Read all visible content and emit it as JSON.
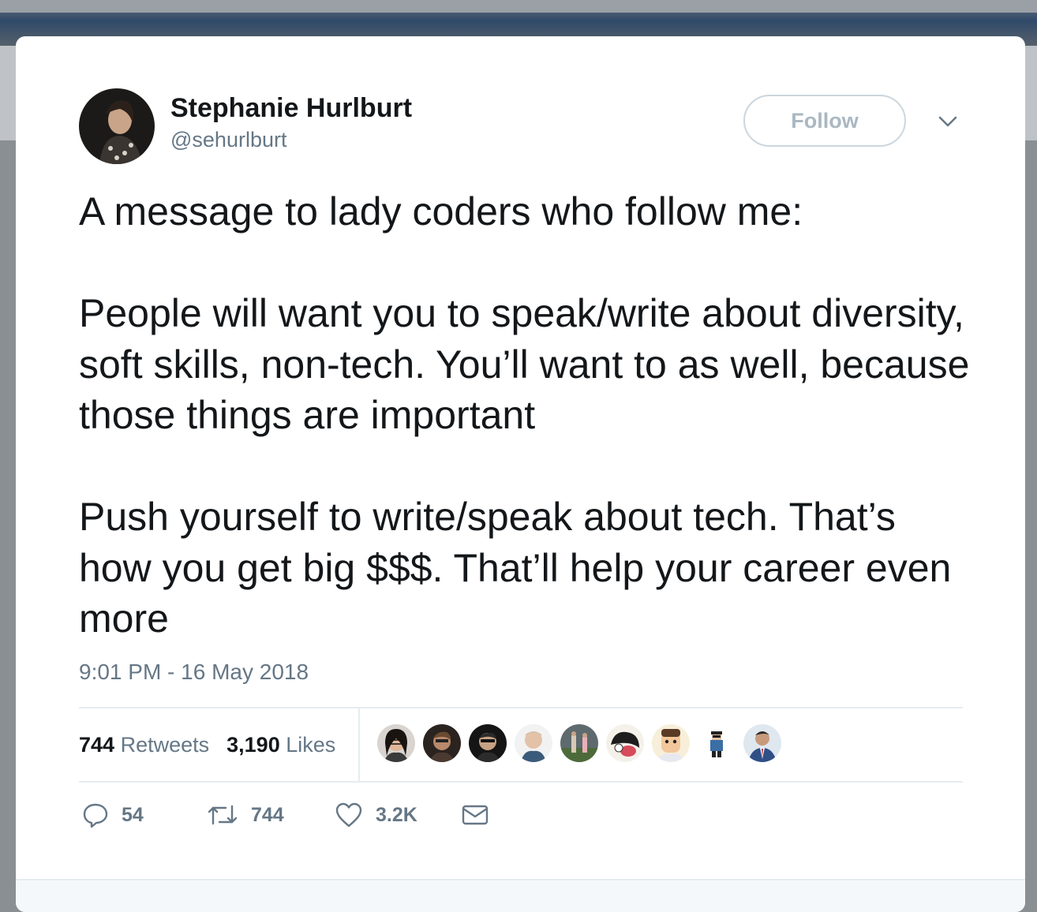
{
  "tweet": {
    "author_name": "Stephanie Hurlburt",
    "author_handle": "@sehurlburt",
    "follow_label": "Follow",
    "text": "A message to lady coders who follow me:\n\nPeople will want you to speak/write about diversity, soft skills, non-tech. You’ll want to as well, because those things are important\n\nPush yourself to write/speak about tech. That’s how you get big $$$. That’ll help your career even more",
    "timestamp": "9:01 PM - 16 May 2018",
    "stats": {
      "retweets_count": "744",
      "retweets_label": "Retweets",
      "likes_count": "3,190",
      "likes_label": "Likes"
    },
    "actions": {
      "reply_count": "54",
      "retweet_count": "744",
      "like_count": "3.2K"
    }
  },
  "icons": {
    "reply": "reply-icon",
    "retweet": "retweet-icon",
    "like": "heart-icon",
    "dm": "envelope-icon",
    "menu": "chevron-down-icon"
  },
  "colors": {
    "text": "#14171a",
    "secondary": "#657786",
    "border": "#e6ecf0",
    "follow_border": "#ccd6dd"
  }
}
